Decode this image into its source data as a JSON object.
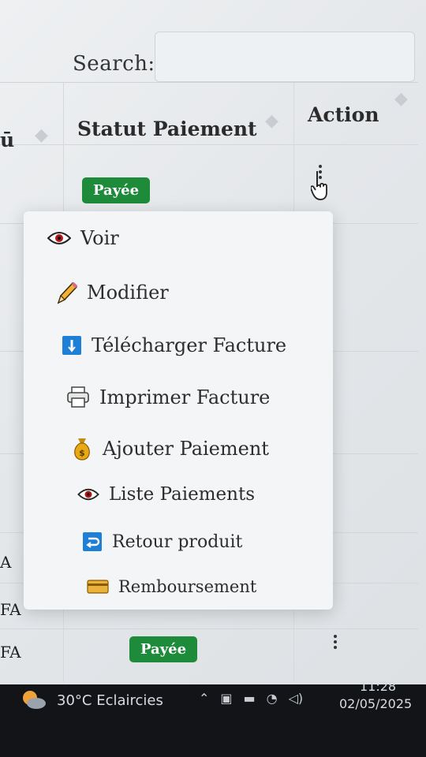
{
  "search": {
    "label": "Search:"
  },
  "table": {
    "headers": {
      "left_partial": "ū",
      "statut": "Statut Paiement",
      "action": "Action"
    },
    "rows": [
      {
        "statut": "Payée"
      },
      {
        "statut": "Payée"
      }
    ],
    "left_edge": [
      "A",
      "FA",
      "FA"
    ]
  },
  "menu": {
    "items": [
      {
        "label": "Voir",
        "icon": "eye-icon"
      },
      {
        "label": "Modifier",
        "icon": "pencil-icon"
      },
      {
        "label": "Télécharger Facture",
        "icon": "download-icon"
      },
      {
        "label": "Imprimer Facture",
        "icon": "printer-icon"
      },
      {
        "label": "Ajouter Paiement",
        "icon": "money-bag-icon"
      },
      {
        "label": "Liste Paiements",
        "icon": "eye-icon"
      },
      {
        "label": "Retour produit",
        "icon": "return-icon"
      },
      {
        "label": "Remboursement",
        "icon": "credit-card-icon"
      }
    ]
  },
  "taskbar": {
    "weather": "30°C  Eclaircies",
    "time": "11:28",
    "date": "02/05/2025"
  },
  "colors": {
    "badge_green": "#1e8b3a",
    "download_blue": "#1e7fd6"
  }
}
